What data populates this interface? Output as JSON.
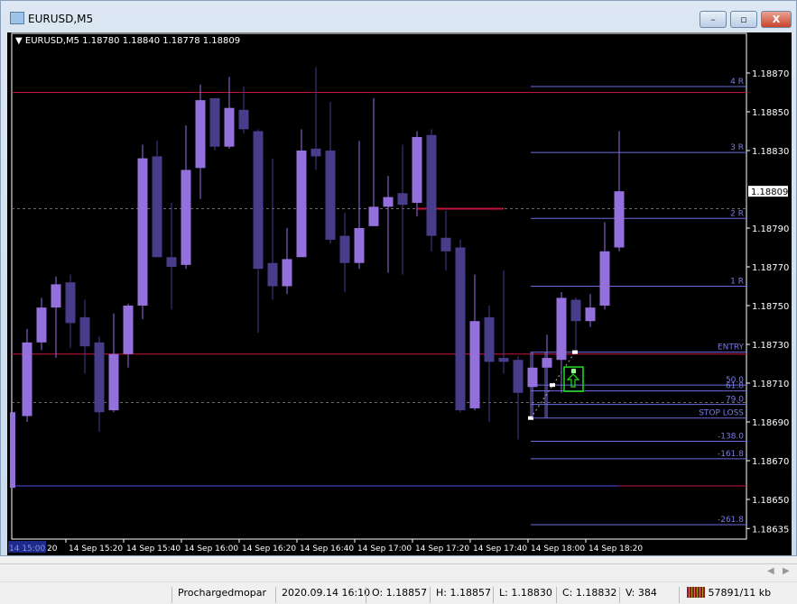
{
  "window": {
    "title": "EURUSD,M5",
    "minimize": "–",
    "maximize": "▫",
    "close": "X"
  },
  "chart_header": "EURUSD,M5  1.18780 1.18840 1.18778 1.18809",
  "colors": {
    "bull": "#9370db",
    "bear": "#483d8b",
    "level_red": "#c8143c",
    "fib": "#6c6ce0",
    "fib_text": "#7a7ae6",
    "navy": "#27277a",
    "signal": "#22dd22"
  },
  "chart_data": {
    "type": "candlestick",
    "symbol": "EURUSD",
    "timeframe": "M5",
    "ylim": [
      1.18632,
      1.18875
    ],
    "price_ticks": [
      "1.18870",
      "1.18850",
      "1.18830",
      "1.18790",
      "1.18770",
      "1.18750",
      "1.18730",
      "1.18710",
      "1.18690",
      "1.18670",
      "1.18650",
      "1.18635"
    ],
    "current_price": "1.18809",
    "time_labels": [
      "14 Sep 15:20",
      "14 Sep 15:40",
      "14 Sep 16:00",
      "14 Sep 16:20",
      "14 Sep 16:40",
      "14 Sep 17:00",
      "14 Sep 17:20",
      "14 Sep 17:40",
      "14 Sep 18:00",
      "14 Sep 18:20"
    ],
    "time_cursor": "14 15:00",
    "first_time": "15:00",
    "interval_minutes": 5,
    "ohlc": [
      [
        1.18656,
        1.18695,
        1.18656,
        1.18695
      ],
      [
        1.18693,
        1.18738,
        1.1869,
        1.18731
      ],
      [
        1.18731,
        1.18754,
        1.18727,
        1.18749
      ],
      [
        1.18749,
        1.18765,
        1.18723,
        1.18761
      ],
      [
        1.18762,
        1.18766,
        1.18728,
        1.18741
      ],
      [
        1.18744,
        1.18753,
        1.18715,
        1.18729
      ],
      [
        1.18731,
        1.18734,
        1.18685,
        1.18695
      ],
      [
        1.18696,
        1.18746,
        1.18695,
        1.18725
      ],
      [
        1.18725,
        1.18751,
        1.18718,
        1.1875
      ],
      [
        1.1875,
        1.18833,
        1.18743,
        1.18826
      ],
      [
        1.18827,
        1.18835,
        1.18775,
        1.18775
      ],
      [
        1.18775,
        1.18803,
        1.18748,
        1.1877
      ],
      [
        1.18771,
        1.18843,
        1.18769,
        1.1882
      ],
      [
        1.18821,
        1.18864,
        1.18805,
        1.18856
      ],
      [
        1.18857,
        1.18857,
        1.1883,
        1.18832
      ],
      [
        1.18832,
        1.18868,
        1.18831,
        1.18852
      ],
      [
        1.18851,
        1.18863,
        1.18839,
        1.18841
      ],
      [
        1.1884,
        1.18841,
        1.18736,
        1.18769
      ],
      [
        1.18772,
        1.18826,
        1.18753,
        1.1876
      ],
      [
        1.1876,
        1.1879,
        1.18756,
        1.18774
      ],
      [
        1.18775,
        1.18841,
        1.18775,
        1.1883
      ],
      [
        1.18831,
        1.18873,
        1.1882,
        1.18827
      ],
      [
        1.1883,
        1.18855,
        1.18782,
        1.18784
      ],
      [
        1.18786,
        1.18798,
        1.18757,
        1.18772
      ],
      [
        1.18772,
        1.18835,
        1.18769,
        1.1879
      ],
      [
        1.18791,
        1.18857,
        1.18791,
        1.18801
      ],
      [
        1.18801,
        1.18817,
        1.18767,
        1.18806
      ],
      [
        1.18808,
        1.18833,
        1.18766,
        1.18802
      ],
      [
        1.18803,
        1.1884,
        1.18796,
        1.18837
      ],
      [
        1.18838,
        1.18841,
        1.18778,
        1.18786
      ],
      [
        1.18785,
        1.18799,
        1.18768,
        1.18778
      ],
      [
        1.1878,
        1.18784,
        1.18695,
        1.18696
      ],
      [
        1.18697,
        1.18766,
        1.18696,
        1.18742
      ],
      [
        1.18744,
        1.1875,
        1.1869,
        1.18721
      ],
      [
        1.18723,
        1.18768,
        1.18715,
        1.18721
      ],
      [
        1.18722,
        1.18724,
        1.18681,
        1.18705
      ],
      [
        1.18708,
        1.18726,
        1.18692,
        1.18718
      ],
      [
        1.18718,
        1.18735,
        1.18692,
        1.18723
      ],
      [
        1.18722,
        1.18757,
        1.18705,
        1.18754
      ],
      [
        1.18753,
        1.18754,
        1.18727,
        1.18742
      ],
      [
        1.18742,
        1.18756,
        1.18739,
        1.18749
      ],
      [
        1.1875,
        1.18793,
        1.18748,
        1.18778
      ],
      [
        1.1878,
        1.1884,
        1.18778,
        1.18809
      ]
    ],
    "horizontal_levels": [
      {
        "price": 1.1886,
        "color": "red"
      },
      {
        "price": 1.18725,
        "color": "red"
      },
      {
        "price": 1.188,
        "color": "gray-dashed"
      },
      {
        "price": 1.187,
        "color": "gray-dashed"
      },
      {
        "price": 1.18657,
        "color": "navy-red"
      }
    ],
    "short_level": {
      "price": 1.188,
      "from_bar": 28,
      "to_bar": 34,
      "color": "red"
    },
    "fib_levels": [
      {
        "label": "4  R",
        "price": 1.18863
      },
      {
        "label": "3  R",
        "price": 1.18829
      },
      {
        "label": "2  R",
        "price": 1.18795
      },
      {
        "label": "1  R",
        "price": 1.1876
      },
      {
        "label": "ENTRY",
        "price": 1.18726
      },
      {
        "label": "50.0",
        "price": 1.18709
      },
      {
        "label": "61.8",
        "price": 1.18706
      },
      {
        "label": "79.0",
        "price": 1.18699
      },
      {
        "label": "STOP LOSS",
        "price": 1.18692
      },
      {
        "label": "-138.0",
        "price": 1.1868
      },
      {
        "label": "-161.8",
        "price": 1.18671
      },
      {
        "label": "-261.8",
        "price": 1.18637
      }
    ],
    "fib_anchor": {
      "from_bar": 36,
      "to_bar": 39,
      "from_price": 1.18692,
      "to_price": 1.18726
    },
    "signal": {
      "type": "buy-arrow",
      "bar": 39,
      "price": 1.18716
    }
  },
  "status": {
    "profile": "Prochargedmopar",
    "datetime": "2020.09.14 16:10",
    "open": "O: 1.18857",
    "high": "H: 1.18857",
    "low": "L: 1.18830",
    "close": "C: 1.18832",
    "volume": "V: 384",
    "traffic": "57891/11 kb"
  },
  "scroll": {
    "left": "◀",
    "right": "▶"
  }
}
